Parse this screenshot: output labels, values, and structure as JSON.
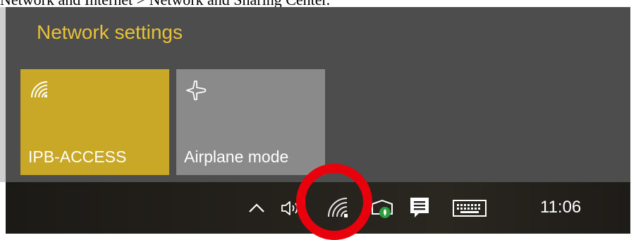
{
  "caption": {
    "text": "Network and Internet > Network and Sharing Center."
  },
  "flyout": {
    "title": "Network settings",
    "accent_color": "#e9c23a",
    "tiles": [
      {
        "label": "IPB-ACCESS",
        "icon": "wifi-icon",
        "active": true,
        "color": "#c9a828"
      },
      {
        "label": "Airplane mode",
        "icon": "airplane-icon",
        "active": false,
        "color": "#8a8a8a"
      }
    ]
  },
  "taskbar": {
    "icons": [
      "chevron-up-icon",
      "volume-icon",
      "wifi-icon",
      "onedrive-icon",
      "action-center-icon",
      "touch-keyboard-icon"
    ],
    "clock": "11:06"
  },
  "annotation": {
    "highlight_color": "#e8000c",
    "target": "wifi-icon"
  }
}
